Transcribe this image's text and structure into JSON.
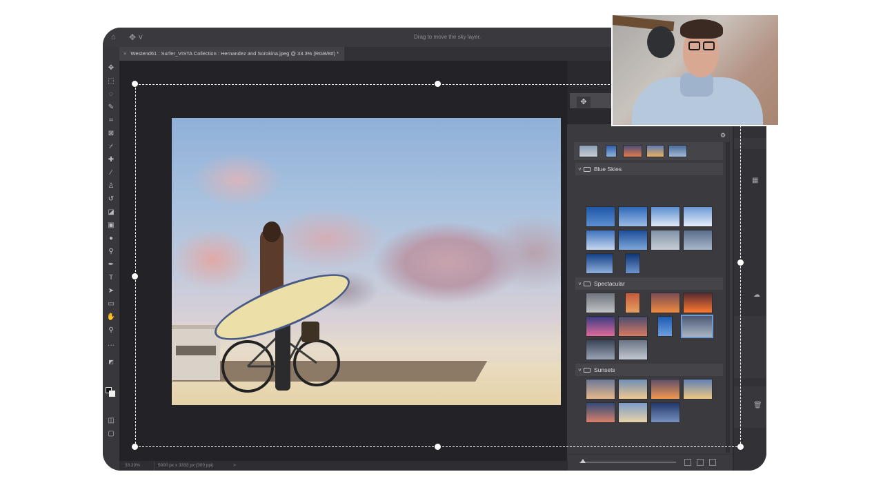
{
  "app": {
    "hint_text": "Drag to move the sky layer.",
    "document_tab": "Westend61 : Surfer_VISTA Collection : Hernandez and Sorokina.jpeg @ 33.3% (RGB/8#) *",
    "tab_close": "×"
  },
  "tools": [
    "move",
    "marquee",
    "lasso",
    "quick-select",
    "crop",
    "frame",
    "eyedropper",
    "healing",
    "brush",
    "clone-stamp",
    "history-brush",
    "eraser",
    "gradient",
    "blur",
    "dodge",
    "pen",
    "type",
    "path-select",
    "rectangle",
    "hand",
    "zoom",
    "more"
  ],
  "sky_panel": {
    "folders": [
      {
        "label": "Blue Skies"
      },
      {
        "label": "Spectacular"
      },
      {
        "label": "Sunsets"
      }
    ],
    "selected_thumb": "spectacular-8"
  },
  "status": {
    "zoom": "33.33%",
    "dimensions": "5000 px x 3333 px (300 ppi)",
    "arrow": ">"
  },
  "colors": {
    "window_bg": "#2a292d",
    "panel_bg": "#3b3a3e",
    "selection": "#ffffff",
    "selected_thumb_border": "#6d9bd3"
  }
}
